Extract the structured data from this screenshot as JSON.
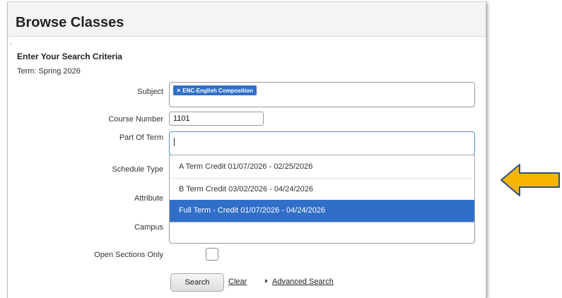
{
  "header": {
    "title": "Browse Classes"
  },
  "criteria": {
    "title": "Enter Your Search Criteria",
    "term": "Term: Spring 2026"
  },
  "fields": {
    "subject": {
      "label": "Subject",
      "chips": [
        {
          "remove": "×",
          "text": "ENC-English Composition"
        }
      ]
    },
    "course_number": {
      "label": "Course Number",
      "value": "1101"
    },
    "part_of_term": {
      "label": "Part Of Term",
      "value": ""
    },
    "schedule_type": {
      "label": "Schedule Type"
    },
    "attribute": {
      "label": "Attribute"
    },
    "campus": {
      "label": "Campus"
    },
    "open_sections": {
      "label": "Open Sections Only",
      "checked": false
    }
  },
  "dropdown": {
    "options": [
      {
        "text": "A Term Credit 01/07/2026 - 02/25/2026",
        "selected": false
      },
      {
        "text": "B Term Credit 03/02/2026 - 04/24/2026",
        "selected": false
      },
      {
        "text": "Full Term - Credit 01/07/2026 - 04/24/2026",
        "selected": true
      }
    ]
  },
  "actions": {
    "search": "Search",
    "clear": "Clear",
    "advanced": "Advanced Search"
  },
  "colors": {
    "accent": "#2f6fc8",
    "arrow_fill": "#f5b400",
    "arrow_stroke": "#2e4f8a"
  }
}
